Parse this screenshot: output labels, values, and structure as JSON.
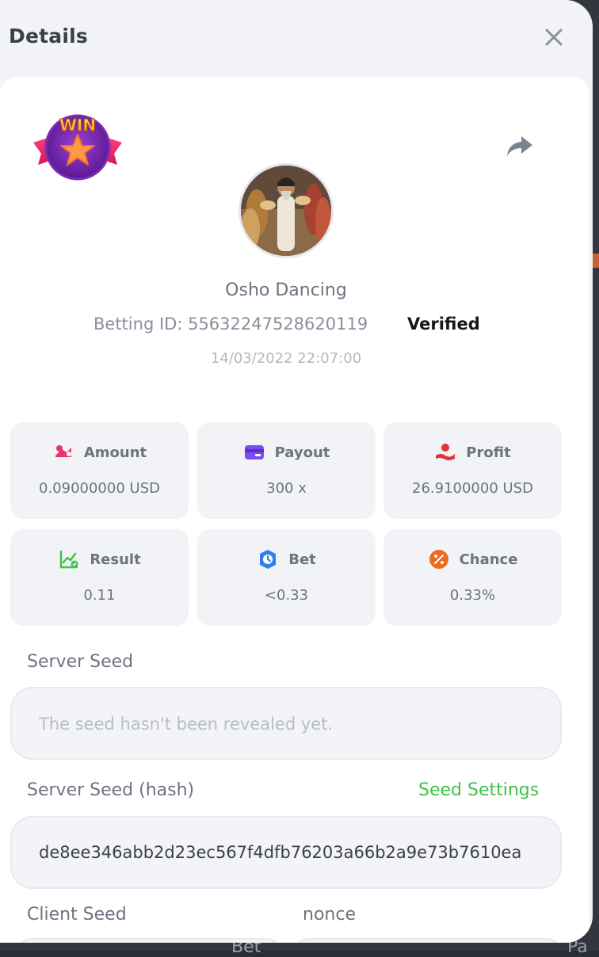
{
  "header": {
    "title": "Details"
  },
  "game": {
    "name": "Osho Dancing",
    "betting_id_label": "Betting ID:",
    "betting_id": "55632247528620119",
    "verified_label": "Verified",
    "timestamp": "14/03/2022 22:07:00",
    "badge_text": "WIN"
  },
  "stats": [
    {
      "label": "Amount",
      "value": "0.09000000 USD",
      "icon": "amount-icon",
      "color": "#e8336d"
    },
    {
      "label": "Payout",
      "value": "300 x",
      "icon": "payout-card-icon",
      "color": "#7b4cf0"
    },
    {
      "label": "Profit",
      "value": "26.9100000 USD",
      "icon": "profit-hand-icon",
      "color": "#e0323a"
    },
    {
      "label": "Result",
      "value": "0.11",
      "icon": "result-chart-icon",
      "color": "#3fc34a"
    },
    {
      "label": "Bet",
      "value": "<0.33",
      "icon": "bet-clock-icon",
      "color": "#2f80ed"
    },
    {
      "label": "Chance",
      "value": "0.33%",
      "icon": "chance-percent-icon",
      "color": "#ee6a1f"
    }
  ],
  "server_seed": {
    "label": "Server Seed",
    "placeholder": "The seed hasn't been revealed yet."
  },
  "server_seed_hash": {
    "label": "Server Seed (hash)",
    "settings_link": "Seed Settings",
    "value": "de8ee346abb2d23ec567f4dfb76203a66b2a9e73b7610ea"
  },
  "client_seed": {
    "label": "Client Seed"
  },
  "nonce": {
    "label": "nonce"
  },
  "background": {
    "peek_text_1": "Bet",
    "peek_text_2": "Pa"
  },
  "colors": {
    "accent_green": "#3fc34a",
    "panel_bg": "#f2f3f7",
    "card_bg": "#ffffff"
  }
}
